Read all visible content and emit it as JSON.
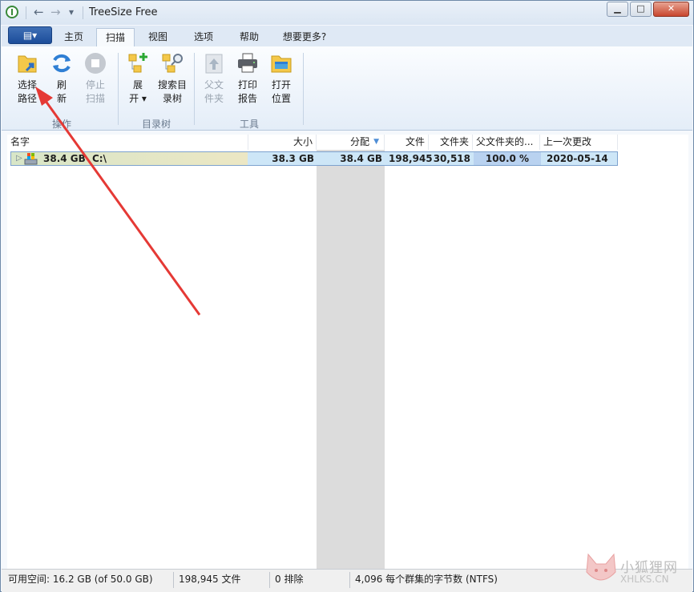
{
  "window": {
    "title": "TreeSize Free",
    "qat_back": "←",
    "qat_forward": "→",
    "qat_dropdown": "▾",
    "minimize": "▁",
    "maximize": "□",
    "close": "✕"
  },
  "tabs": {
    "appmenu": "▤▾",
    "items": [
      "主页",
      "扫描",
      "视图",
      "选项",
      "帮助",
      "想要更多?"
    ],
    "active_index": 1
  },
  "ribbon": {
    "select_path": [
      "选择",
      "路径"
    ],
    "refresh": [
      "刷",
      "新"
    ],
    "stop_scan": [
      "停止",
      "扫描"
    ],
    "group_operations": "操作",
    "expand": [
      "展",
      "开 ▾"
    ],
    "search_tree": [
      "搜索目",
      "录树"
    ],
    "group_tree": "目录树",
    "parent_folder": [
      "父文",
      "件夹"
    ],
    "print_report": [
      "打印",
      "报告"
    ],
    "open_location": [
      "打开",
      "位置"
    ],
    "group_tools": "工具"
  },
  "columns": {
    "name": "名字",
    "size": "大小",
    "allocated": "分配",
    "files": "文件",
    "folders": "文件夹",
    "percent_parent": "父文件夹的...",
    "last_modified": "上一次更改"
  },
  "rows": [
    {
      "expander": "▷",
      "name_size": "38.4 GB",
      "name": "C:\\",
      "size": "38.3 GB",
      "allocated": "38.4 GB",
      "files": "198,945",
      "folders": "30,518",
      "percent": "100.0 %",
      "modified": "2020-05-14"
    }
  ],
  "status": {
    "free_space": "可用空间: 16.2 GB  (of 50.0 GB)",
    "file_count": "198,945 文件",
    "excluded": "0 排除",
    "cluster": "4,096 每个群集的字节数 (NTFS)"
  },
  "watermark": {
    "line1": "小狐狸网",
    "line2": "XHLKS.CN"
  },
  "colors": {
    "accent_blue": "#1c4d9a",
    "selection": "#cde6f7",
    "annotation_arrow": "#e53935",
    "alloc_column_shade": "#dcdcdc"
  }
}
